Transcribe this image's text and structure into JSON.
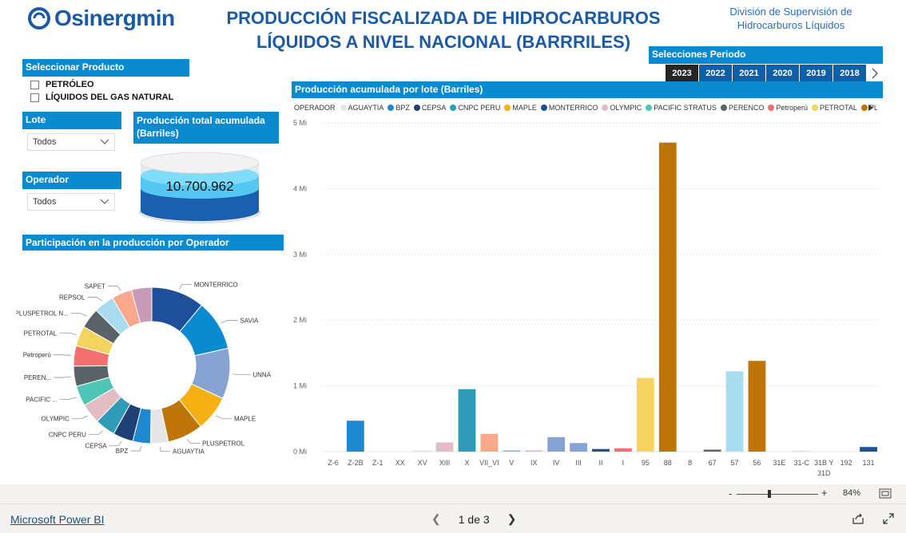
{
  "header": {
    "logo_text": "Osinergmin",
    "title_line1": "PRODUCCIÓN FISCALIZADA DE HIDROCARBUROS",
    "title_line2": "LÍQUIDOS A NIVEL NACIONAL (BARRRILES)",
    "division_line1": "División de Supervisión de",
    "division_line2": "Hidrocarburos Líquidos"
  },
  "filters": {
    "producto_header": "Seleccionar Producto",
    "productos": [
      "PETRÓLEO",
      "LÍQUIDOS DEL GAS NATURAL"
    ],
    "lote_header": "Lote",
    "lote_value": "Todos",
    "operador_header": "Operador",
    "operador_value": "Todos",
    "periodo_header": "Selecciones Periodo",
    "years": [
      "2023",
      "2022",
      "2021",
      "2020",
      "2019",
      "2018"
    ],
    "selected_year": "2023"
  },
  "kpi": {
    "header": "Producción total acumulada (Barriles)",
    "value": "10.700.962"
  },
  "colors": {
    "accent": "#0a8bd0",
    "brand": "#1b5aa6"
  },
  "chart_data": [
    {
      "type": "bar",
      "title": "Producción acumulada por lote (Barriles)",
      "legend_title": "OPERADOR",
      "legend": [
        {
          "name": "AGUAYTIA",
          "color": "#e6e6e6"
        },
        {
          "name": "BPZ",
          "color": "#1e88d0"
        },
        {
          "name": "CEPSA",
          "color": "#1f3f77"
        },
        {
          "name": "CNPC PERU",
          "color": "#2f9bb8"
        },
        {
          "name": "MAPLE",
          "color": "#f6b012"
        },
        {
          "name": "MONTERRICO",
          "color": "#1e4f9b"
        },
        {
          "name": "OLYMPIC",
          "color": "#e3bcc4"
        },
        {
          "name": "PACIFIC STRATUS",
          "color": "#4fc5b8"
        },
        {
          "name": "PERENCO",
          "color": "#5a6468"
        },
        {
          "name": "Petroperú",
          "color": "#f46f6f"
        },
        {
          "name": "PETROTAL",
          "color": "#f4d35e"
        },
        {
          "name": "PLUSPETROL",
          "color": "#bf7408"
        }
      ],
      "yticks": [
        "0 Mi",
        "1 Mi",
        "2 Mi",
        "3 Mi",
        "4 Mi",
        "5 Mi"
      ],
      "ylim": [
        0,
        5
      ],
      "categories": [
        "Z-6",
        "Z-2B",
        "Z-1",
        "XX",
        "XV",
        "XIII",
        "X",
        "VII_VI",
        "V",
        "IX",
        "IV",
        "III",
        "II",
        "I",
        "95",
        "88",
        "8",
        "67",
        "57",
        "56",
        "31E",
        "31-C",
        "31B Y 31D",
        "192",
        "131"
      ],
      "values": [
        0,
        0.47,
        0,
        0,
        0.01,
        0.14,
        0.95,
        0.27,
        0.01,
        0.02,
        0.22,
        0.13,
        0.04,
        0.05,
        1.12,
        4.7,
        0,
        0.03,
        1.22,
        1.38,
        0,
        0.01,
        0,
        0,
        0.07
      ],
      "colors": [
        "#e6e6e6",
        "#1e88d0",
        "#e6e6e6",
        "#e6e6e6",
        "#e6e6e6",
        "#e3bcc4",
        "#2f9bb8",
        "#f9a88c",
        "#8fb0d8",
        "#e3bcc4",
        "#86a3d4",
        "#86a3d4",
        "#1e4f9b",
        "#f46f6f",
        "#f4d35e",
        "#bf7408",
        "#e6e6e6",
        "#5a6468",
        "#a9dcee",
        "#bf7408",
        "#e6e6e6",
        "#e6e6e6",
        "#e6e6e6",
        "#e6e6e6",
        "#1e4f9b"
      ]
    },
    {
      "type": "pie",
      "title": "Participación en la producción por Operador",
      "slices": [
        {
          "label": "MONTERRICO",
          "value": 10.5,
          "color": "#1e4f9b"
        },
        {
          "label": "SAVIA",
          "value": 10.0,
          "color": "#0a8bd0"
        },
        {
          "label": "UNNA",
          "value": 10.0,
          "color": "#86a3d4"
        },
        {
          "label": "MAPLE",
          "value": 7.0,
          "color": "#f6b012"
        },
        {
          "label": "PLUSPETROL",
          "value": 7.0,
          "color": "#bf7408"
        },
        {
          "label": "AGUAYTIA",
          "value": 3.5,
          "color": "#e6e6e6"
        },
        {
          "label": "BPZ",
          "value": 3.5,
          "color": "#1e88d0"
        },
        {
          "label": "CEPSA",
          "value": 4.0,
          "color": "#1f3f77"
        },
        {
          "label": "CNPC PERU",
          "value": 4.0,
          "color": "#2f9bb8"
        },
        {
          "label": "OLYMPIC",
          "value": 4.0,
          "color": "#e3bcc4"
        },
        {
          "label": "PACIFIC ...",
          "value": 4.0,
          "color": "#4fc5b8"
        },
        {
          "label": "PEREN...",
          "value": 4.0,
          "color": "#5a6468"
        },
        {
          "label": "Petroperú",
          "value": 4.0,
          "color": "#f46f6f"
        },
        {
          "label": "PETROTAL",
          "value": 4.0,
          "color": "#f4d35e"
        },
        {
          "label": "PLUSPETROL N...",
          "value": 4.0,
          "color": "#5a6468"
        },
        {
          "label": "REPSOL",
          "value": 4.0,
          "color": "#a9dcee"
        },
        {
          "label": "SAPET",
          "value": 4.0,
          "color": "#f9a88c"
        },
        {
          "label": "",
          "value": 4.0,
          "color": "#c89ab8"
        }
      ]
    }
  ],
  "footer": {
    "powerbi_link": "Microsoft Power BI",
    "page_indicator": "1 de 3",
    "zoom": "84%"
  }
}
